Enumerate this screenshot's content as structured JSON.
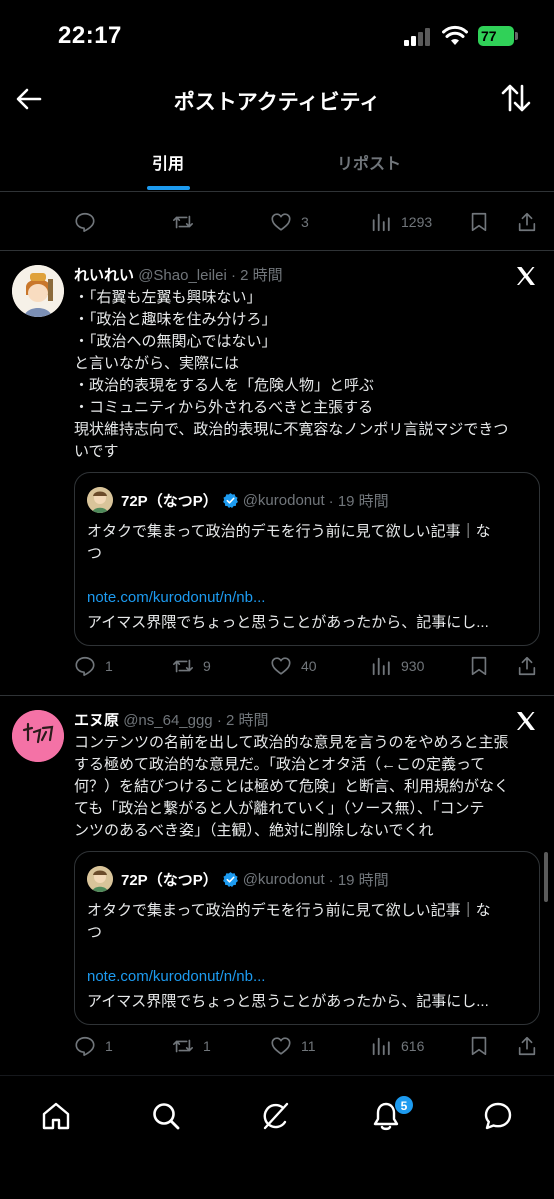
{
  "status_bar": {
    "time": "22:17",
    "battery": "77"
  },
  "header": {
    "title": "ポストアクティビティ"
  },
  "tabs": [
    {
      "label": "引用"
    },
    {
      "label": "リポスト"
    }
  ],
  "top_actions": {
    "replies": "",
    "reposts": "",
    "likes": "3",
    "views": "1293"
  },
  "tweets": [
    {
      "name": "れいれい",
      "handle": "@Shao_leilei",
      "time": "· 2 時間",
      "lines": [
        "・「右翼も左翼も興味ない」",
        "・「政治と趣味を住み分けろ」",
        "・「政治への無関心ではない」",
        "と言いながら、実際には",
        "・政治的表現をする人を「危険人物」と呼ぶ",
        "・コミュニティから外されるべきと主張する",
        "現状維持志向で、政治的表現に不寛容なノンポリ言説マジできつ",
        "いです"
      ],
      "quote": {
        "name": "72P（なつP）",
        "handle": "@kurodonut",
        "time": "· 19 時間",
        "line1": "オタクで集まって政治的デモを行う前に見て欲しい記事｜な",
        "line2": "つ",
        "link": "note.com/kurodonut/n/nb...",
        "desc": "アイマス界隈でちょっと思うことがあったから、記事にし..."
      },
      "replies": "1",
      "reposts": "9",
      "likes": "40",
      "views": "930"
    },
    {
      "name": "エヌ原",
      "handle": "@ns_64_ggg",
      "time": "· 2 時間",
      "avatar_text": "トサカ",
      "lines": [
        "コンテンツの名前を出して政治的な意見を言うのをやめろと主張",
        "する極めて政治的な意見だ。「政治とオタ活（←この定義って",
        "何？）を結びつけることは極めて危険」と断言、利用規約がなく",
        "ても「政治と繋がると人が離れていく」（ソース無）、「コンテ",
        "ンツのあるべき姿」（主観）、絶対に削除しないでくれ"
      ],
      "quote": {
        "name": "72P（なつP）",
        "handle": "@kurodonut",
        "time": "· 19 時間",
        "line1": "オタクで集まって政治的デモを行う前に見て欲しい記事｜な",
        "line2": "つ",
        "link": "note.com/kurodonut/n/nb...",
        "desc": "アイマス界隈でちょっと思うことがあったから、記事にし..."
      },
      "replies": "1",
      "reposts": "1",
      "likes": "11",
      "views": "616"
    }
  ],
  "bottom_nav": {
    "notifications_badge": "5"
  },
  "colors": {
    "accent": "#1d9bf0",
    "secondary_text": "#71767b",
    "divider": "#2f3336"
  }
}
